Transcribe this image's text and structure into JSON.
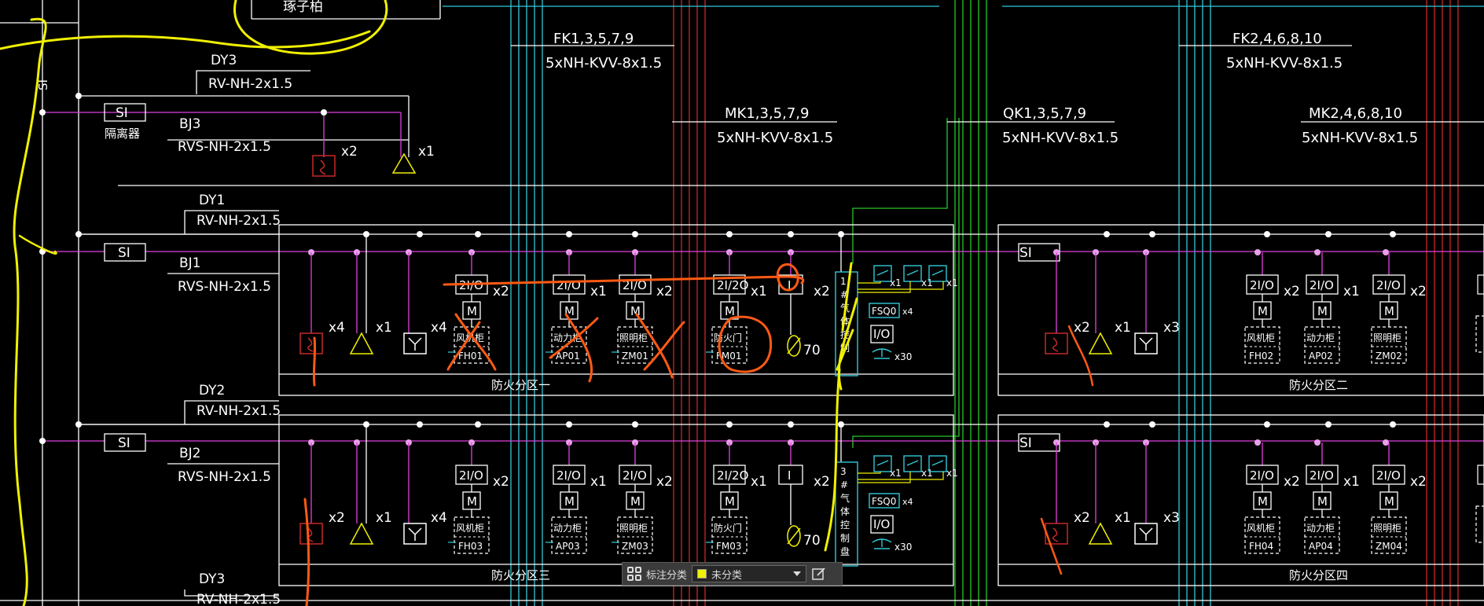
{
  "colors": {
    "background": "#000000",
    "white": "#ffffff",
    "magenta": "#e040e0",
    "cyan": "#30c8d8",
    "red": "#c82828",
    "green": "#28c828",
    "yellow": "#f0f000",
    "orange": "#ff5a14"
  },
  "top_text": "琢子柏",
  "vertical_si": "SI",
  "dy3_top": {
    "label": "DY3",
    "cable": "RV-NH-2x1.5"
  },
  "si_top": {
    "label": "SI",
    "sublabel": "隔离器"
  },
  "bj3": {
    "label": "BJ3",
    "cable": "RVS-NH-2x1.5"
  },
  "top_devices": [
    {
      "mult": "x2"
    },
    {
      "mult": "x1"
    }
  ],
  "fk_left": {
    "label": "FK1,3,5,7,9",
    "cable": "5xNH-KVV-8x1.5"
  },
  "fk_right": {
    "label": "FK2,4,6,8,10",
    "cable": "5xNH-KVV-8x1.5"
  },
  "mk_left": {
    "label": "MK1,3,5,7,9",
    "cable": "5xNH-KVV-8x1.5"
  },
  "qk": {
    "label": "QK1,3,5,7,9",
    "cable": "5xNH-KVV-8x1.5"
  },
  "mk_right": {
    "label": "MK2,4,6,8,10",
    "cable": "5xNH-KVV-8x1.5"
  },
  "row1": {
    "dy": "DY1",
    "dy_cable": "RV-NH-2x1.5",
    "si": "SI",
    "bj": "BJ1",
    "bj_cable": "RVS-NH-2x1.5",
    "devices": [
      {
        "mult": "x4"
      },
      {
        "mult": "x1"
      },
      {
        "mult": "x4"
      }
    ],
    "modules": [
      {
        "io": "2I/O",
        "m": "M",
        "panel": "风机柜",
        "code": "FH01",
        "mult": "x2"
      },
      {
        "io": "2I/O",
        "m": "M",
        "panel": "动力柜",
        "code": "AP01",
        "mult": "x1"
      },
      {
        "io": "2I/O",
        "m": "M",
        "panel": "照明柜",
        "code": "ZM01",
        "mult": "x2"
      },
      {
        "io": "2I/2O",
        "m": "M",
        "panel": "防火门",
        "code": "FM01",
        "mult": "x1"
      }
    ],
    "i_module": {
      "label": "I",
      "mult": "x2",
      "valve": "70"
    },
    "gas": {
      "label": "1#气体控制",
      "fsq": "FSQ0",
      "fsq_mult": "x4",
      "io": "I/O",
      "n_mult": "x30",
      "icon_mults": [
        "x1",
        "x1",
        "x1"
      ]
    },
    "zone_left": "防火分区一",
    "zone_right": "防火分区二",
    "right_si": "SI",
    "right_devices": [
      {
        "mult": "x2"
      },
      {
        "mult": "x1"
      },
      {
        "mult": "x3"
      }
    ],
    "right_modules": [
      {
        "io": "2I/O",
        "m": "M",
        "panel": "风机柜",
        "code": "FH02",
        "mult": "x2"
      },
      {
        "io": "2I/O",
        "m": "M",
        "panel": "动力柜",
        "code": "AP02",
        "mult": "x1"
      },
      {
        "io": "2I/O",
        "m": "M",
        "panel": "照明柜",
        "code": "ZM02",
        "mult": "x2"
      }
    ]
  },
  "row2": {
    "dy": "DY2",
    "dy_cable": "RV-NH-2x1.5",
    "si": "SI",
    "bj": "BJ2",
    "bj_cable": "RVS-NH-2x1.5",
    "devices": [
      {
        "mult": "x2"
      },
      {
        "mult": "x1"
      },
      {
        "mult": "x4"
      }
    ],
    "modules": [
      {
        "io": "2I/O",
        "m": "M",
        "panel": "风机柜",
        "code": "FH03",
        "mult": "x2"
      },
      {
        "io": "2I/O",
        "m": "M",
        "panel": "动力柜",
        "code": "AP03",
        "mult": "x1"
      },
      {
        "io": "2I/O",
        "m": "M",
        "panel": "照明柜",
        "code": "ZM03",
        "mult": "x2"
      },
      {
        "io": "2I/2O",
        "m": "M",
        "panel": "防火门",
        "code": "FM03",
        "mult": "x1"
      }
    ],
    "i_module": {
      "label": "I",
      "mult": "x2",
      "valve": "70"
    },
    "gas": {
      "label": "3#气体控制盘",
      "fsq": "FSQ0",
      "fsq_mult": "x4",
      "io": "I/O",
      "n_mult": "x30",
      "icon_mults": [
        "x1",
        "x1",
        "x1"
      ]
    },
    "zone_left": "防火分区三",
    "zone_right": "防火分区四",
    "right_si": "SI",
    "right_devices": [
      {
        "mult": "x2"
      },
      {
        "mult": "x1"
      },
      {
        "mult": "x3"
      }
    ],
    "right_modules": [
      {
        "io": "2I/O",
        "m": "M",
        "panel": "风机柜",
        "code": "FH04",
        "mult": "x2"
      },
      {
        "io": "2I/O",
        "m": "M",
        "panel": "动力柜",
        "code": "AP04",
        "mult": "x1"
      },
      {
        "io": "2I/O",
        "m": "M",
        "panel": "照明柜",
        "code": "ZM04",
        "mult": "x2"
      }
    ]
  },
  "dy3_bottom": {
    "label": "DY3",
    "cable": "RV-NH-2x1.5"
  },
  "toolbar": {
    "label": "标注分类",
    "selected": "未分类",
    "selected_color": "#f0f000"
  }
}
